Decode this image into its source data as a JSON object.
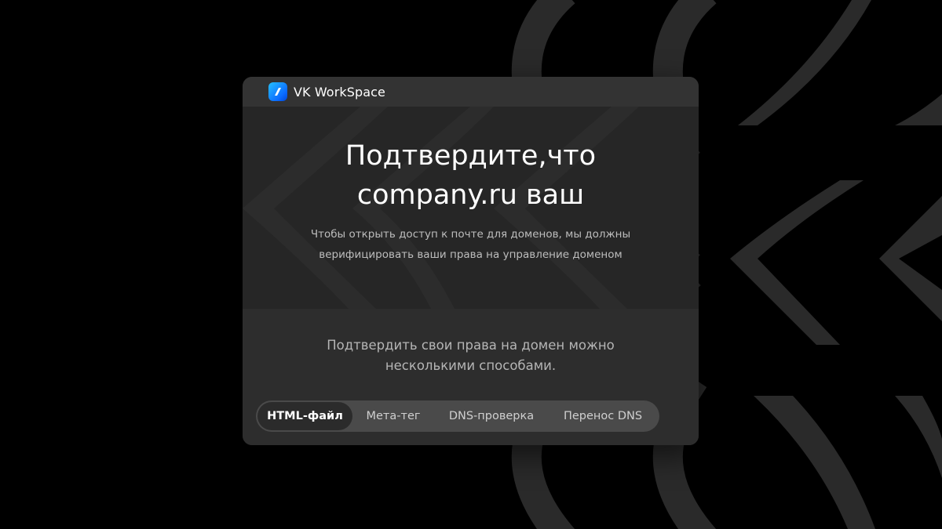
{
  "brand": {
    "name": "VK WorkSpace",
    "logo_icon": "vk-workspace-logo-icon"
  },
  "hero": {
    "title_line1": "Подтвердите,что",
    "title_line2": "company.ru ваш",
    "subtitle_line1": "Чтобы открыть доступ к почте для доменов, мы должны",
    "subtitle_line2": "верифицировать ваши права на управление доменом"
  },
  "methods": {
    "intro_line1": "Подтвердить свои права на домен можно",
    "intro_line2": "несколькими способами.",
    "tabs": [
      {
        "label": "HTML-файл",
        "active": true
      },
      {
        "label": "Мета-тег",
        "active": false
      },
      {
        "label": "DNS-проверка",
        "active": false
      },
      {
        "label": "Перенос DNS",
        "active": false
      }
    ]
  },
  "colors": {
    "background": "#000000",
    "pattern": "#2a2a2a",
    "card": "#2d2d2d",
    "accent": "#0a6cff"
  }
}
